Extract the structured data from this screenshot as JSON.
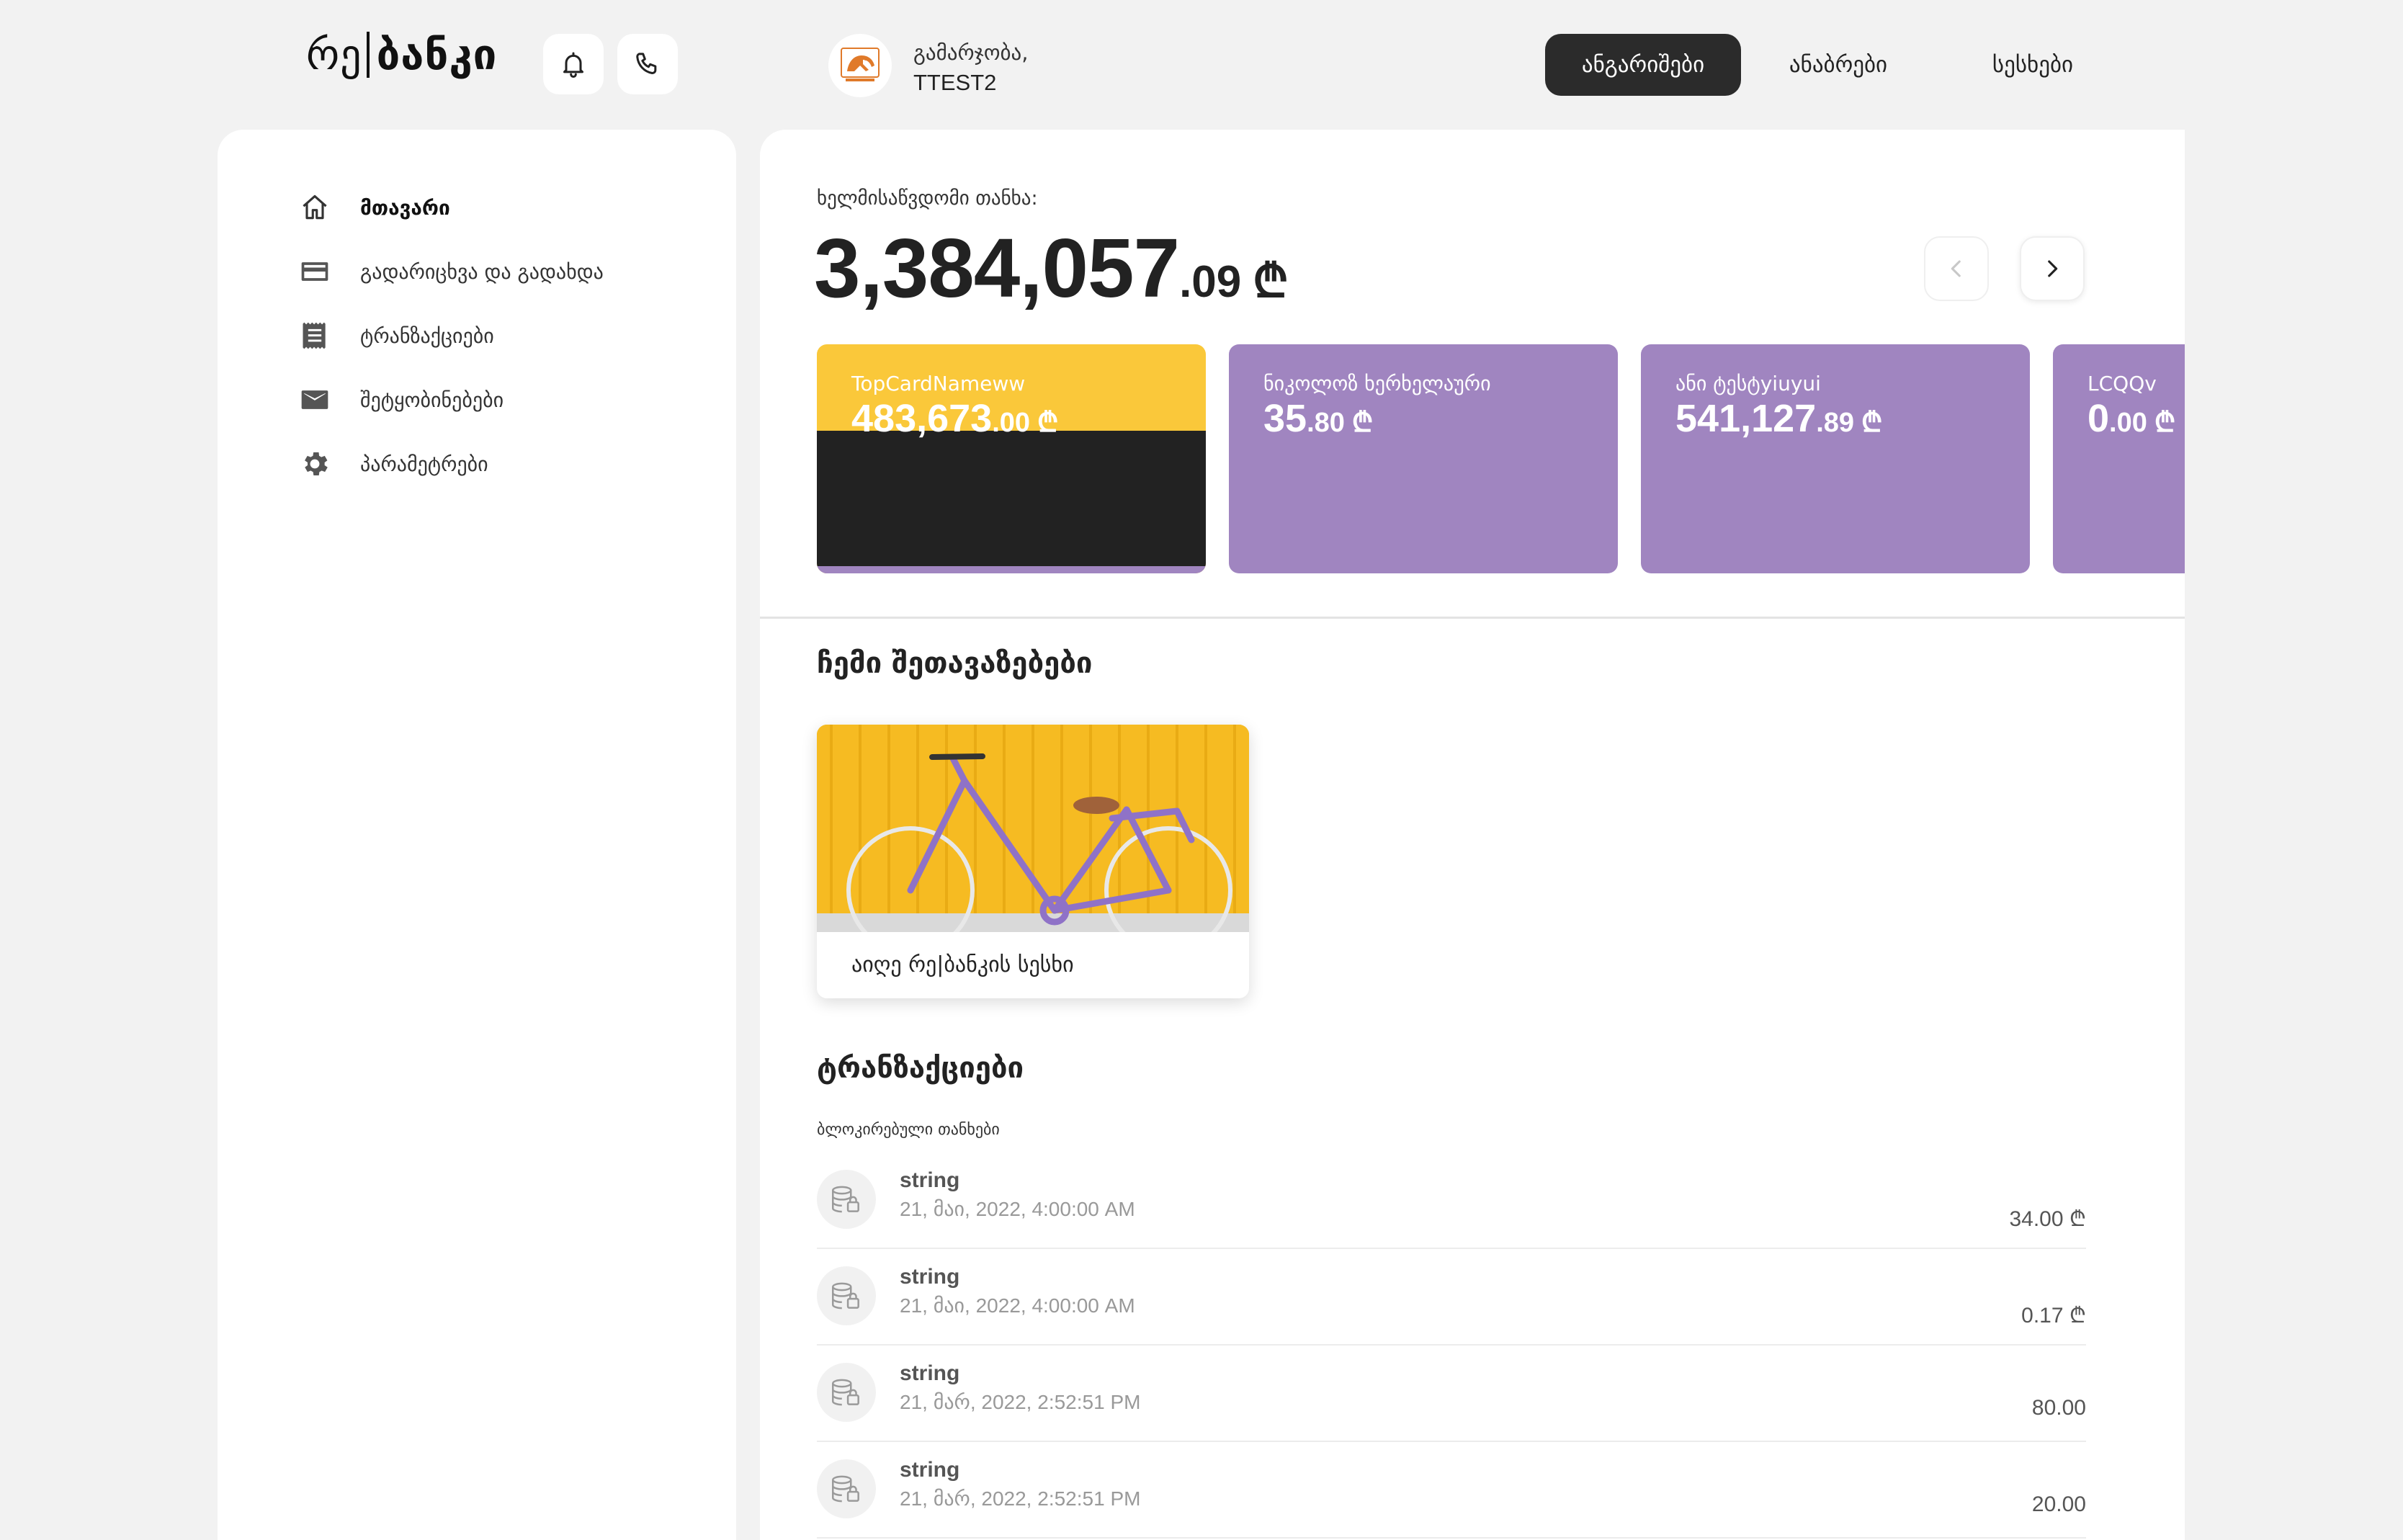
{
  "header": {
    "logo_light": "რე",
    "logo_bold": "ბანკი",
    "greeting": "გამარჯობა,",
    "user_name": "TTEST2",
    "nav": [
      {
        "label": "ანგარიშები",
        "active": true
      },
      {
        "label": "ანაბრები",
        "active": false
      },
      {
        "label": "სესხები",
        "active": false
      }
    ]
  },
  "sidebar": {
    "items": [
      {
        "label": "მთავარი",
        "icon": "home-icon",
        "active": true
      },
      {
        "label": "გადარიცხვა და გადახდა",
        "icon": "card-icon",
        "active": false
      },
      {
        "label": "ტრანზაქციები",
        "icon": "receipt-icon",
        "active": false
      },
      {
        "label": "შეტყობინებები",
        "icon": "mail-icon",
        "active": false
      },
      {
        "label": "პარამეტრები",
        "icon": "gear-icon",
        "active": false
      }
    ]
  },
  "balance": {
    "label": "ხელმისაწვდომი თანხა:",
    "integer": "3,384,057",
    "decimal": ".09",
    "currency": "₾"
  },
  "cards": [
    {
      "name": "TopCardNameww",
      "integer": "483,673",
      "decimal": ".00",
      "currency": "₾",
      "style": "yellow-black"
    },
    {
      "name": "ნიკოლოზ ხერხელაური",
      "integer": "35",
      "decimal": ".80",
      "currency": "₾",
      "style": "purple"
    },
    {
      "name": "ანი ტესტyiuyui",
      "integer": "541,127",
      "decimal": ".89",
      "currency": "₾",
      "style": "purple"
    },
    {
      "name": "LCQQv",
      "integer": "0",
      "decimal": ".00",
      "currency": "₾",
      "style": "purple"
    }
  ],
  "offers": {
    "title": "ჩემი შეთავაზებები",
    "items": [
      {
        "title": "აიღე რე|ბანკის სესხი",
        "image": "bicycle-on-yellow-wall"
      }
    ]
  },
  "transactions": {
    "title": "ტრანზაქციები",
    "subtitle": "ბლოკირებული თანხები",
    "rows": [
      {
        "name": "string",
        "date": "21, მაი, 2022, 4:00:00 AM",
        "amount": "34.00 ₾"
      },
      {
        "name": "string",
        "date": "21, მაი, 2022, 4:00:00 AM",
        "amount": "0.17 ₾"
      },
      {
        "name": "string",
        "date": "21, მარ, 2022, 2:52:51 PM",
        "amount": "80.00"
      },
      {
        "name": "string",
        "date": "21, მარ, 2022, 2:52:51 PM",
        "amount": "20.00"
      }
    ]
  },
  "colors": {
    "background": "#f2f2f2",
    "active_tab": "#2b2b2b",
    "card_purple": "#a085c0",
    "card_yellow": "#fac83a",
    "card_dark": "#222222"
  }
}
